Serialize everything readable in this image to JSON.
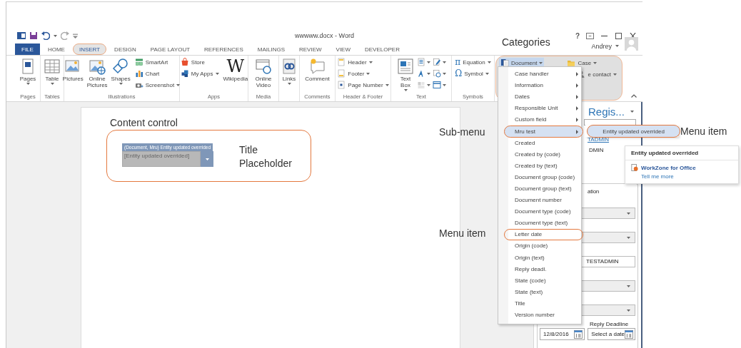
{
  "window": {
    "title": "wwwww.docx - Word",
    "help": "?",
    "user": "Andrey"
  },
  "tabs": [
    {
      "label": "FILE",
      "kind": "file",
      "selected": false,
      "circled": false
    },
    {
      "label": "HOME",
      "kind": "tab",
      "selected": false,
      "circled": false
    },
    {
      "label": "INSERT",
      "kind": "tab",
      "selected": true,
      "circled": true
    },
    {
      "label": "DESIGN",
      "kind": "tab",
      "selected": false,
      "circled": false
    },
    {
      "label": "PAGE LAYOUT",
      "kind": "tab",
      "selected": false,
      "circled": false
    },
    {
      "label": "REFERENCES",
      "kind": "tab",
      "selected": false,
      "circled": false
    },
    {
      "label": "MAILINGS",
      "kind": "tab",
      "selected": false,
      "circled": false
    },
    {
      "label": "REVIEW",
      "kind": "tab",
      "selected": false,
      "circled": false
    },
    {
      "label": "VIEW",
      "kind": "tab",
      "selected": false,
      "circled": false
    },
    {
      "label": "DEVELOPER",
      "kind": "tab",
      "selected": false,
      "circled": false
    }
  ],
  "ribbon": {
    "groups": [
      {
        "label": "Pages",
        "circled": false,
        "columns": [
          [
            {
              "label": "Pages",
              "kind": "large",
              "dropdown": true,
              "selected": false
            }
          ]
        ]
      },
      {
        "label": "Tables",
        "circled": false,
        "columns": [
          [
            {
              "label": "Table",
              "kind": "large",
              "dropdown": true,
              "selected": false
            }
          ]
        ]
      },
      {
        "label": "Illustrations",
        "circled": false,
        "columns": [
          [
            {
              "label": "Pictures",
              "kind": "large",
              "dropdown": false,
              "selected": false
            }
          ],
          [
            {
              "label": "Online Pictures",
              "kind": "large",
              "dropdown": false,
              "selected": false
            }
          ],
          [
            {
              "label": "Shapes",
              "kind": "large",
              "dropdown": true,
              "selected": false
            }
          ],
          [
            {
              "label": "SmartArt",
              "kind": "small",
              "dropdown": false,
              "selected": false
            },
            {
              "label": "Chart",
              "kind": "small",
              "dropdown": false,
              "selected": false
            },
            {
              "label": "Screenshot",
              "kind": "small",
              "dropdown": true,
              "selected": false
            }
          ]
        ]
      },
      {
        "label": "Apps",
        "circled": false,
        "columns": [
          [
            {
              "label": "Store",
              "kind": "small",
              "dropdown": false,
              "selected": false
            },
            {
              "label": "My Apps",
              "kind": "small",
              "dropdown": true,
              "selected": false
            }
          ],
          [
            {
              "label": "Wikipedia",
              "kind": "large",
              "dropdown": false,
              "selected": false,
              "glyph": "W"
            }
          ]
        ]
      },
      {
        "label": "Media",
        "circled": false,
        "columns": [
          [
            {
              "label": "Online Video",
              "kind": "large",
              "dropdown": false,
              "selected": false
            }
          ]
        ]
      },
      {
        "circled": false,
        "columns": [
          [
            {
              "label": "Links",
              "kind": "large",
              "dropdown": true,
              "selected": false
            }
          ]
        ]
      },
      {
        "label": "Comments",
        "circled": false,
        "columns": [
          [
            {
              "label": "Comment",
              "kind": "large",
              "dropdown": false,
              "selected": false
            }
          ]
        ]
      },
      {
        "label": "Header & Footer",
        "circled": false,
        "columns": [
          [
            {
              "label": "Header",
              "kind": "small",
              "dropdown": true,
              "selected": false
            },
            {
              "label": "Footer",
              "kind": "small",
              "dropdown": true,
              "selected": false
            },
            {
              "label": "Page Number",
              "kind": "small",
              "dropdown": true,
              "selected": false
            }
          ]
        ]
      },
      {
        "label": "Text",
        "circled": false,
        "columns": [
          [
            {
              "label": "Text Box",
              "kind": "large",
              "dropdown": true,
              "selected": false
            }
          ],
          [
            {
              "kind": "icon",
              "dropdown": true,
              "selected": false
            },
            {
              "kind": "icon",
              "dropdown": true,
              "selected": false
            },
            {
              "kind": "icon",
              "dropdown": true,
              "selected": false
            }
          ],
          [
            {
              "kind": "icon",
              "dropdown": true,
              "selected": false
            },
            {
              "kind": "icon",
              "dropdown": true,
              "selected": false
            },
            {
              "kind": "icon",
              "dropdown": true,
              "selected": false
            }
          ]
        ]
      },
      {
        "label": "Symbols",
        "circled": false,
        "columns": [
          [
            {
              "label": "Equation",
              "kind": "small",
              "dropdown": true,
              "selected": false,
              "glyph": "π"
            },
            {
              "label": "Symbol",
              "kind": "small",
              "dropdown": true,
              "selected": false,
              "glyph": "Ω"
            }
          ]
        ]
      },
      {
        "circled": true,
        "columns": [
          [
            {
              "label": "Document",
              "kind": "small",
              "dropdown": true,
              "selected": true
            }
          ],
          [
            {
              "label": "Case",
              "kind": "small",
              "dropdown": true,
              "selected": false
            },
            {
              "label": "e contact",
              "kind": "small",
              "dropdown": true,
              "selected": false
            }
          ]
        ]
      }
    ]
  },
  "page": {
    "annotation": "Content control",
    "circled": true,
    "control": {
      "tag": "(Document, Mru) Entity updated overrided",
      "placeholder": "[Entity updated overrided]"
    },
    "note": "Title Placeholder"
  },
  "task_pane": {
    "title": "Regis...",
    "link": "TADMIN",
    "line": "DMIN",
    "group_title": "ation",
    "fields": [
      {
        "kind": "select"
      },
      {
        "kind": "select"
      },
      {
        "kind": "input",
        "value": "TESTADMIN"
      },
      {
        "kind": "select"
      },
      {
        "kind": "select"
      }
    ],
    "date_label": "Reply Deadline",
    "dates": [
      {
        "value": "12/8/2016"
      },
      {
        "value": "Select a date"
      }
    ]
  },
  "menu": {
    "items": [
      {
        "label": "Case handler",
        "submenu": true,
        "selected": false,
        "circled": false
      },
      {
        "label": "Information",
        "submenu": true,
        "selected": false,
        "circled": false
      },
      {
        "label": "Dates",
        "submenu": true,
        "selected": false,
        "circled": false
      },
      {
        "label": "Responsible Unit",
        "submenu": true,
        "selected": false,
        "circled": false
      },
      {
        "label": "Custom field",
        "submenu": true,
        "selected": false,
        "circled": false
      },
      {
        "label": "Mru test",
        "submenu": true,
        "selected": true,
        "circled": true
      },
      {
        "label": "Created",
        "submenu": false,
        "selected": false,
        "circled": false
      },
      {
        "label": "Created by (code)",
        "submenu": false,
        "selected": false,
        "circled": false
      },
      {
        "label": "Created by (text)",
        "submenu": false,
        "selected": false,
        "circled": false
      },
      {
        "label": "Document group (code)",
        "submenu": false,
        "selected": false,
        "circled": false
      },
      {
        "label": "Document group (text)",
        "submenu": false,
        "selected": false,
        "circled": false
      },
      {
        "label": "Document number",
        "submenu": false,
        "selected": false,
        "circled": false
      },
      {
        "label": "Document type (code)",
        "submenu": false,
        "selected": false,
        "circled": false
      },
      {
        "label": "Document type (text)",
        "submenu": false,
        "selected": false,
        "circled": false
      },
      {
        "label": "Letter date",
        "submenu": false,
        "selected": false,
        "circled": true
      },
      {
        "label": "Origin (code)",
        "submenu": false,
        "selected": false,
        "circled": false
      },
      {
        "label": "Origin (text)",
        "submenu": false,
        "selected": false,
        "circled": false
      },
      {
        "label": "Reply deadl.",
        "submenu": false,
        "selected": false,
        "circled": false
      },
      {
        "label": "State (code)",
        "submenu": false,
        "selected": false,
        "circled": false
      },
      {
        "label": "State (text)",
        "submenu": false,
        "selected": false,
        "circled": false
      },
      {
        "label": "Title",
        "submenu": false,
        "selected": false,
        "circled": false
      },
      {
        "label": "Version number",
        "submenu": false,
        "selected": false,
        "circled": false
      }
    ]
  },
  "submenu": {
    "items": [
      {
        "label": "Entity updated overrided",
        "selected": true,
        "circled": true
      }
    ]
  },
  "tooltip": {
    "title": "Entity updated overrided",
    "link": "WorkZone for Office",
    "more": "Tell me more"
  },
  "annotations": [
    {
      "text": "Categories"
    },
    {
      "text": "Sub-menu"
    },
    {
      "text": "Menu item"
    },
    {
      "text": "Menu item"
    }
  ]
}
